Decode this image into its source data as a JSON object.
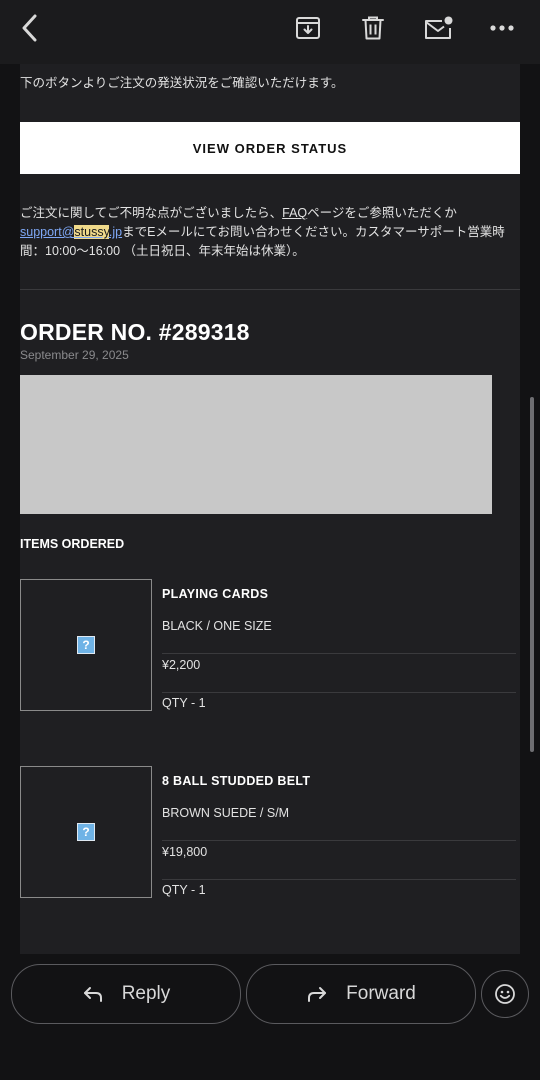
{
  "toolbar": {
    "icons": [
      "back-arrow-icon",
      "archive-icon",
      "trash-icon",
      "mark-unread-icon",
      "more-icon"
    ]
  },
  "email": {
    "intro": "下のボタンよりご注文の発送状況をご確認いただけます。",
    "order_status_button": "VIEW ORDER STATUS",
    "help": {
      "part1": "ご注文に関してご不明な点がございましたら、",
      "faq_link": "FAQ",
      "part2": "ページをご参照いただくか",
      "email_prefix": "support@",
      "email_highlight": "stussy",
      "email_suffix": ".jp",
      "part3": "までEメールにてお問い合わせください。カスタマーサポート営業時間：10:00〜16:00 （土日祝日、年末年始は休業）。"
    },
    "order_number": "ORDER NO. #289318",
    "order_date": "September 29, 2025",
    "items_title": "ITEMS ORDERED",
    "items": [
      {
        "name": "PLAYING CARDS",
        "variant": "BLACK / ONE SIZE",
        "price": "¥2,200",
        "qty": "QTY - 1",
        "image_placeholder": "?"
      },
      {
        "name": "8 BALL STUDDED BELT",
        "variant": "BROWN SUEDE / S/M",
        "price": "¥19,800",
        "qty": "QTY - 1",
        "image_placeholder": "?"
      }
    ]
  },
  "actions": {
    "reply_label": "Reply",
    "forward_label": "Forward",
    "emoji_icon": "smiley-icon"
  }
}
